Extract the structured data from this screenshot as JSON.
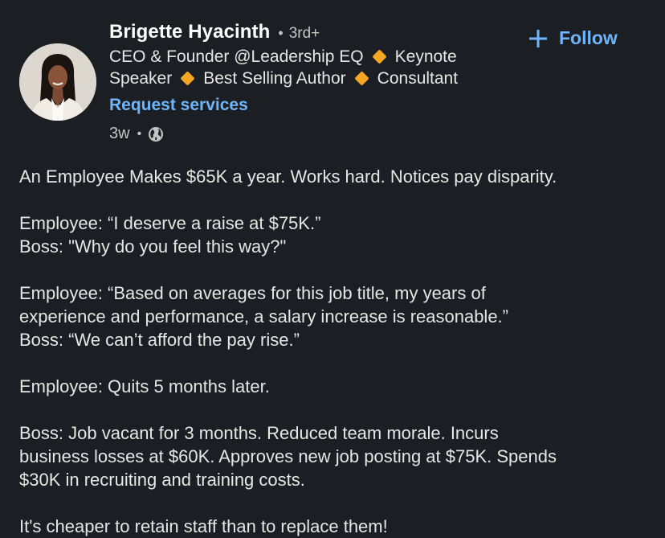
{
  "author": {
    "name": "Brigette Hyacinth",
    "separator": "•",
    "degree": "3rd+",
    "headline_lines": [
      [
        "CEO & Founder @Leadership EQ",
        "Keynote"
      ],
      [
        "Speaker",
        "Best Selling Author",
        "Consultant"
      ]
    ],
    "request_services_label": "Request services",
    "time_ago": "3w",
    "meta_separator": "•",
    "visibility_icon": "globe-icon",
    "avatar_icon": "profile-photo"
  },
  "actions": {
    "follow_label": "Follow",
    "follow_icon": "plus-icon"
  },
  "post": {
    "paragraphs": [
      [
        "An Employee Makes $65K a year. Works hard. Notices pay disparity."
      ],
      [
        "Employee: “I deserve a raise at $75K.”",
        "Boss: \"Why do you feel this way?\""
      ],
      [
        "Employee: “Based on averages for this job title, my years of",
        "experience and performance, a salary increase is reasonable.”",
        "Boss: “We can’t afford the pay rise.”"
      ],
      [
        "Employee: Quits 5 months later."
      ],
      [
        "Boss: Job vacant for 3 months. Reduced team morale. Incurs",
        "business losses at $60K. Approves new job posting at $75K. Spends",
        "$30K in recruiting and training costs."
      ],
      [
        "It's cheaper to retain staff than to replace them!"
      ]
    ]
  },
  "colors": {
    "background": "#1b1f23",
    "link": "#70b5f9",
    "diamond": "#f5a623",
    "text": "#e6e6e6",
    "muted": "#c4c4c4"
  }
}
